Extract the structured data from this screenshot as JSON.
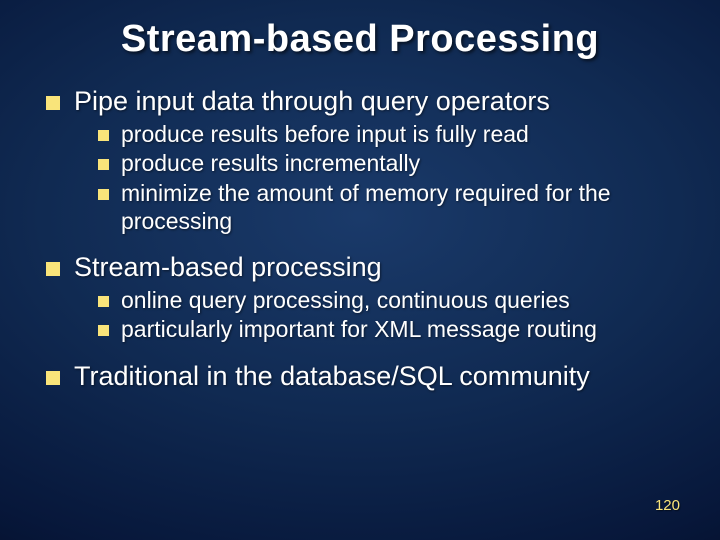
{
  "title": "Stream-based Processing",
  "bullets": {
    "b1": "Pipe input data through query operators",
    "b1_1": "produce results before input is fully read",
    "b1_2": "produce results incrementally",
    "b1_3": "minimize the amount of memory required for the processing",
    "b2": "Stream-based processing",
    "b2_1": "online query processing, continuous queries",
    "b2_2": "particularly important for XML message routing",
    "b3": "Traditional in the database/SQL community"
  },
  "page_number": "120"
}
